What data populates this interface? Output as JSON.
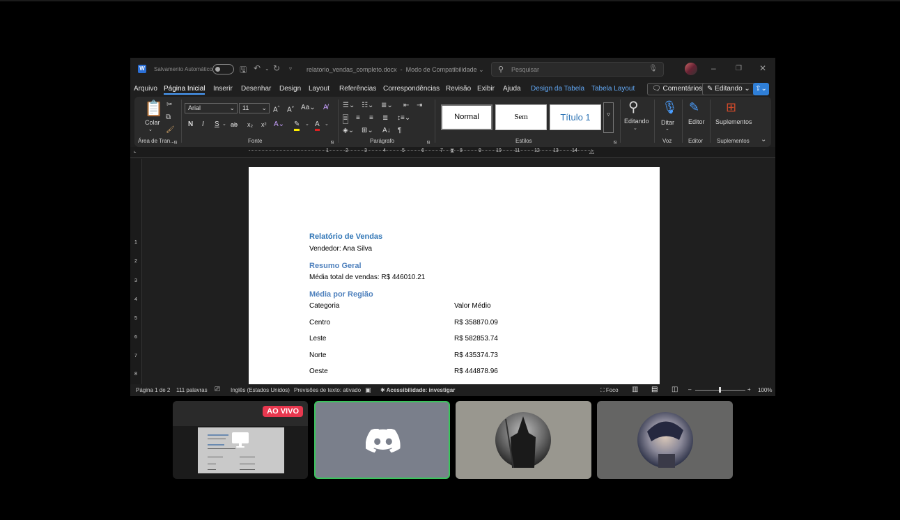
{
  "titlebar": {
    "app_icon": "W",
    "autosave_label": "Salvamento Automático",
    "filename": "relatorio_vendas_completo.docx",
    "mode": "Modo de Compatibilidade",
    "search_placeholder": "Pesquisar"
  },
  "menu": {
    "items": [
      "Arquivo",
      "Página Inicial",
      "Inserir",
      "Desenhar",
      "Design",
      "Layout",
      "Referências",
      "Correspondências",
      "Revisão",
      "Exibir",
      "Ajuda"
    ],
    "context_items": [
      "Design da Tabela",
      "Tabela Layout"
    ],
    "comments_label": "Comentários",
    "editing_label": "Editando"
  },
  "ribbon": {
    "clipboard": {
      "paste": "Colar",
      "group": "Área de Tran..."
    },
    "font": {
      "name": "Arial",
      "size": "11",
      "group": "Fonte",
      "bold": "N",
      "italic": "I",
      "underline": "S",
      "strike": "ab",
      "sub": "x₂",
      "sup": "x²",
      "grow": "A^",
      "shrink": "A˅",
      "case": "Aa"
    },
    "paragraph": {
      "group": "Parágrafo"
    },
    "styles": {
      "normal": "Normal",
      "no_spacing": "Sem Espaçamen",
      "title1": "Título 1",
      "group": "Estilos"
    },
    "editing": {
      "label": "Editando"
    },
    "voice": {
      "label": "Ditar",
      "group": "Voz"
    },
    "editor": {
      "label": "Editor",
      "group": "Editor"
    },
    "addins": {
      "label": "Suplementos",
      "group": "Suplementos"
    }
  },
  "ruler": {
    "h_numbers": [
      "1",
      "2",
      "3",
      "4",
      "5",
      "6",
      "7",
      "8",
      "9",
      "10",
      "11",
      "12",
      "13",
      "14"
    ],
    "v_numbers": [
      "1",
      "2",
      "3",
      "4",
      "5",
      "6",
      "7",
      "8"
    ]
  },
  "document": {
    "title": "Relatório de Vendas",
    "seller": "Vendedor: Ana Silva",
    "summary_heading": "Resumo Geral",
    "summary_text": "Média total de vendas: R$ 446010.21",
    "region_heading": "Média por Região",
    "table": {
      "headers": [
        "Categoria",
        "Valor Médio"
      ],
      "rows": [
        [
          "Centro",
          "R$ 358870.09"
        ],
        [
          "Leste",
          "R$ 582853.74"
        ],
        [
          "Norte",
          "R$ 435374.73"
        ],
        [
          "Oeste",
          "R$ 444878.96"
        ]
      ]
    }
  },
  "status": {
    "page": "Página 1 de 2",
    "words": "111 palavras",
    "language": "Inglês (Estados Unidos)",
    "predictions": "Previsões de texto: ativado",
    "accessibility": "Acessibilidade: investigar",
    "focus": "Foco",
    "zoom": "100%"
  },
  "call": {
    "live_badge": "AO VIVO"
  },
  "colors": {
    "accent": "#2b6fd6",
    "heading": "#2e74b5",
    "discord_green": "#3bc45d",
    "live_red": "#e8384f"
  }
}
